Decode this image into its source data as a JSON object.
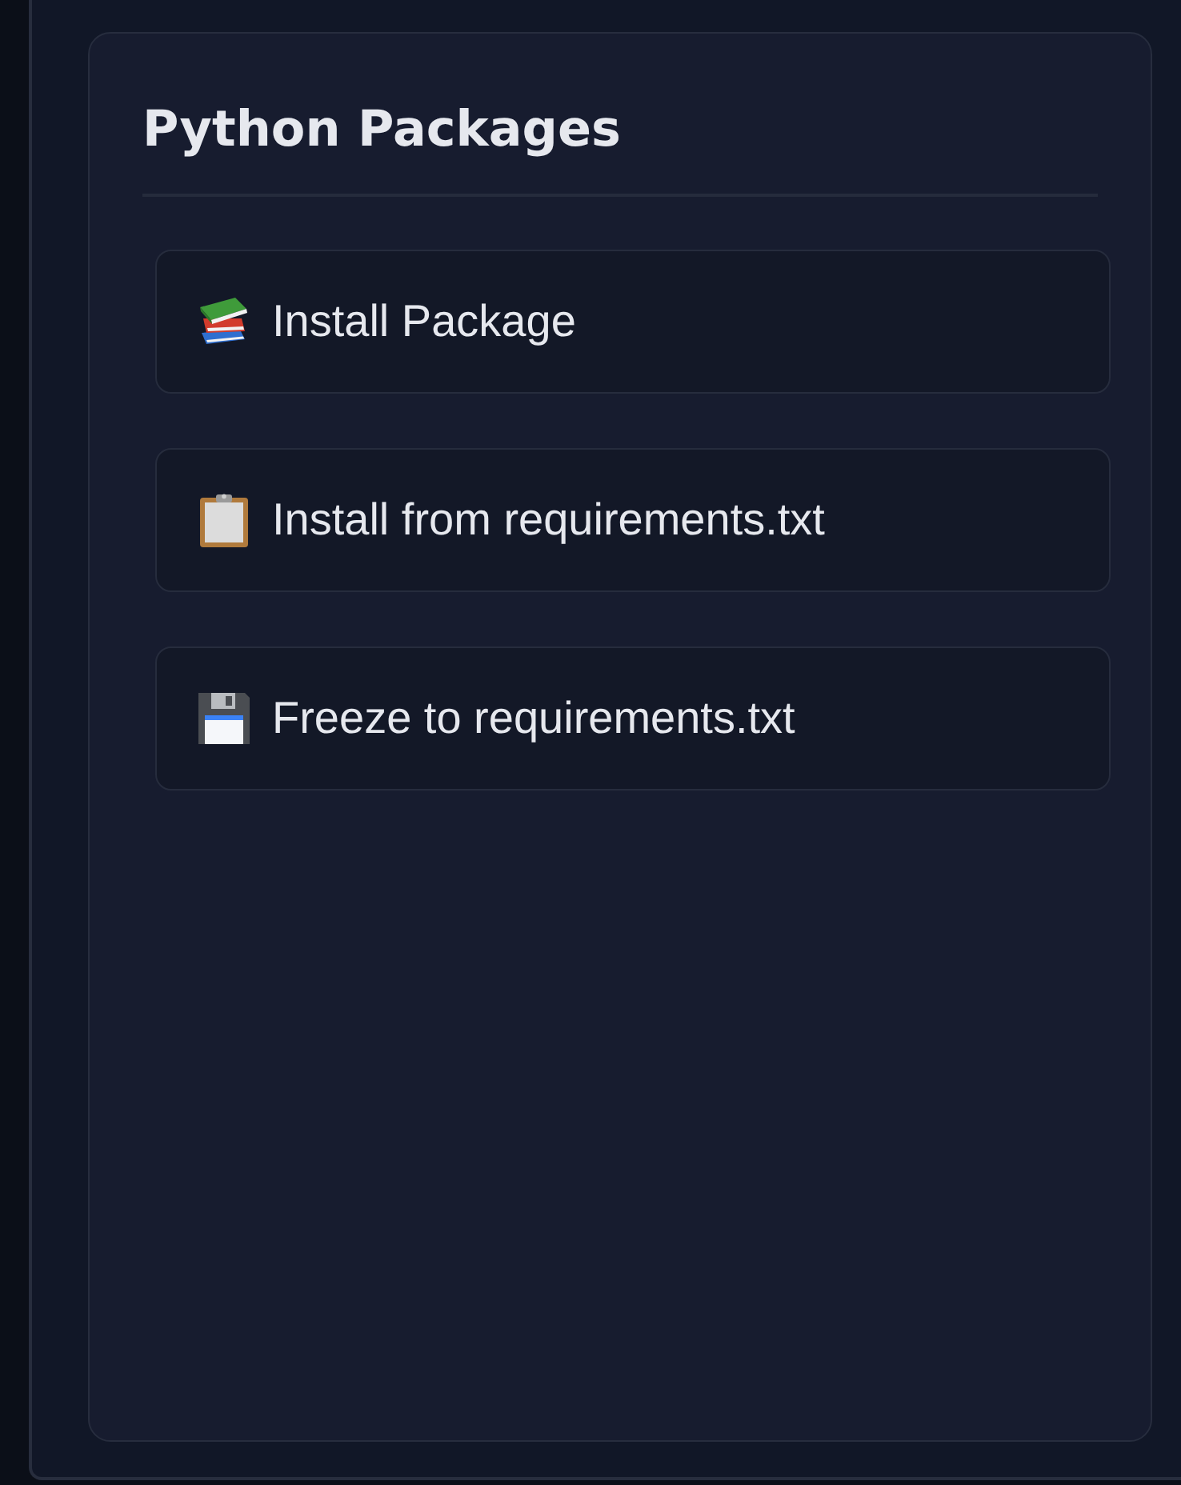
{
  "panel": {
    "title": "Python Packages",
    "actions": [
      {
        "label": "Install Package"
      },
      {
        "label": "Install from requirements.txt"
      },
      {
        "label": "Freeze to requirements.txt"
      }
    ]
  }
}
